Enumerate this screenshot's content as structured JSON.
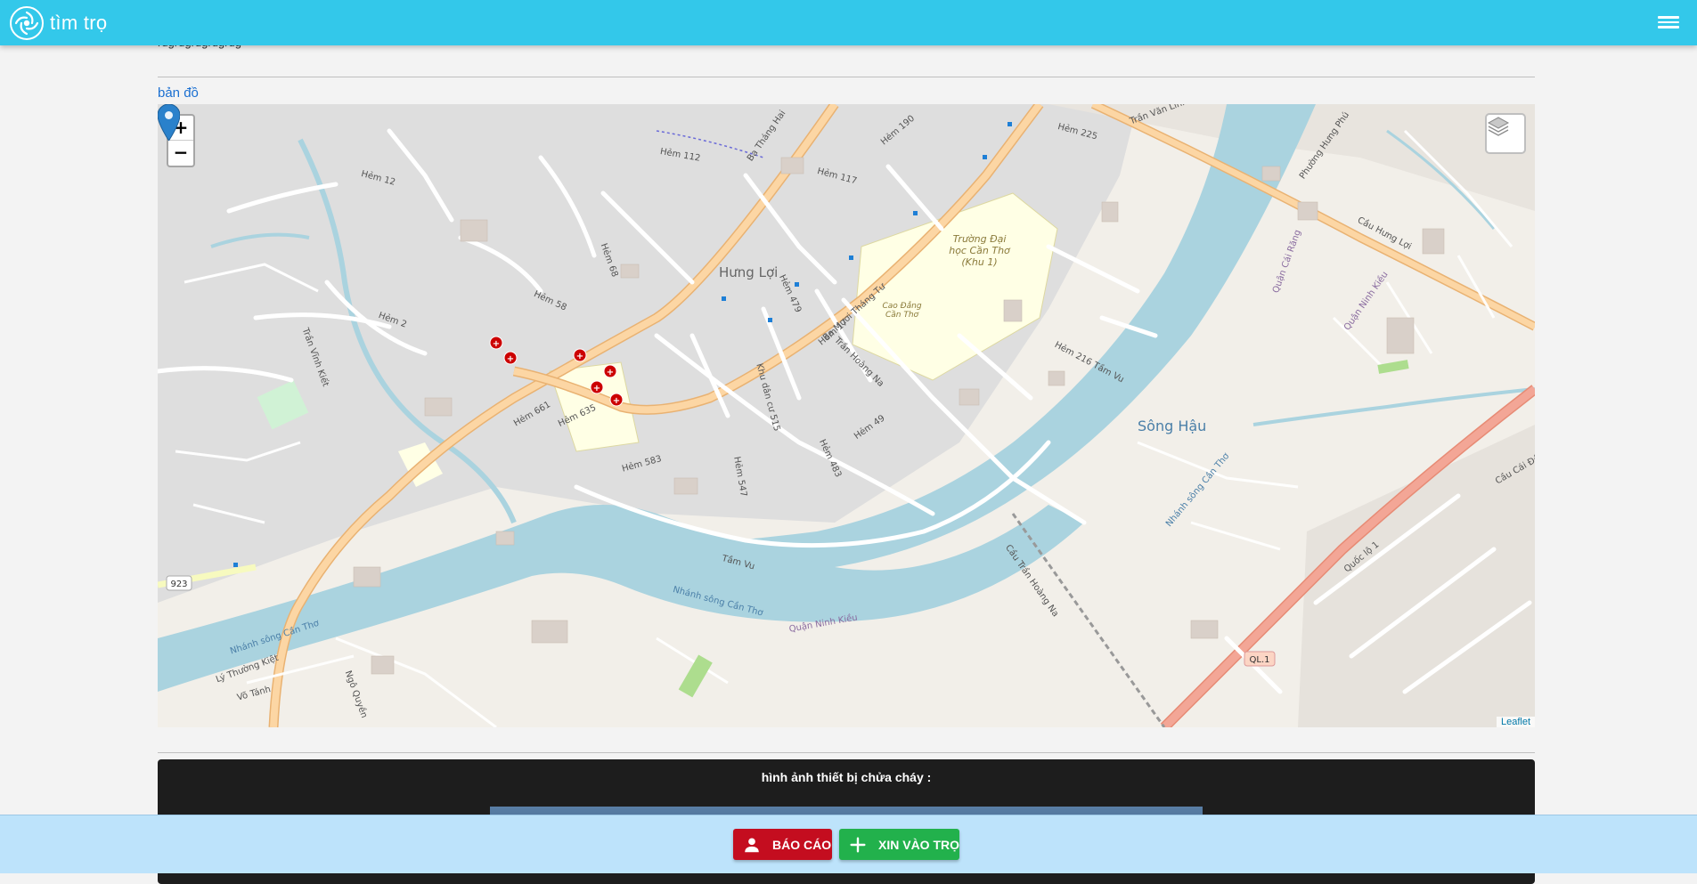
{
  "header": {
    "app_name": "tìm trọ",
    "logo_icon": "swirl-logo-icon",
    "menu_icon": "hamburger-menu-icon",
    "color": "#33c8ea"
  },
  "content": {
    "scrolled_text": "rdgrdgrdgrdgrdg",
    "map_section_label": "bản đồ",
    "fire_section_title": "hình ảnh thiết bị chửa cháy :"
  },
  "map": {
    "zoom_in": "+",
    "zoom_out": "−",
    "layers_icon": "layers-icon",
    "attribution": "Leaflet",
    "marker_icon": "map-pin-icon",
    "labels": {
      "district": "Hưng Lợi",
      "river": "Sông Hậu",
      "university": "Trường Đại học Cần Thơ (Khu 1)",
      "college": "Cao Đẳng Cần Thơ",
      "street1": "Ba Tháng Hai",
      "street2": "Ba Mươi Tháng Tư",
      "street3": "Trần Hoàng Na",
      "street4": "Tầm Vu",
      "street5": "Trần Vĩnh Kiết",
      "street6": "Quốc lộ 1",
      "street7": "Cầu Hưng Lợi",
      "street8": "Cầu Cái Đôi",
      "canal1": "Nhánh sông Cần Thơ",
      "district2": "Quận Ninh Kiều",
      "district3": "Quận Cái Răng",
      "road_badge1": "923",
      "road_badge2": "QL.1",
      "alley1": "Hẻm 12",
      "alley2": "Hẻm 2",
      "alley3": "Hẻm 58",
      "alley4": "Hẻm 68",
      "alley5": "Hẻm 112",
      "alley6": "Hẻm 117",
      "alley7": "Hẻm 190",
      "alley8": "Hẻm 225",
      "alley9": "Hẻm 479",
      "alley10": "Hẻm 17",
      "alley11": "Hẻm 49",
      "alley12": "Hẻm 483",
      "alley13": "Hẻm 547",
      "alley14": "Hẻm 583",
      "alley15": "Hẻm 635",
      "alley16": "Hẻm 661",
      "alley17": "Khu dân cư 515",
      "alley18": "Hẻm 216 Tầm Vu",
      "street9": "Lý Thường Kiệt",
      "street10": "Võ Tánh",
      "street11": "Ngô Quyền",
      "street12": "Phường Hưng Phú",
      "street13": "Trần Văn Linh",
      "street14": "Cầu Trần Hoàng Na"
    }
  },
  "bottom": {
    "report_label": "BÁO CÁO",
    "report_icon": "person-icon",
    "apply_label": "XIN VÀO TRỌ",
    "apply_icon": "plus-icon"
  }
}
